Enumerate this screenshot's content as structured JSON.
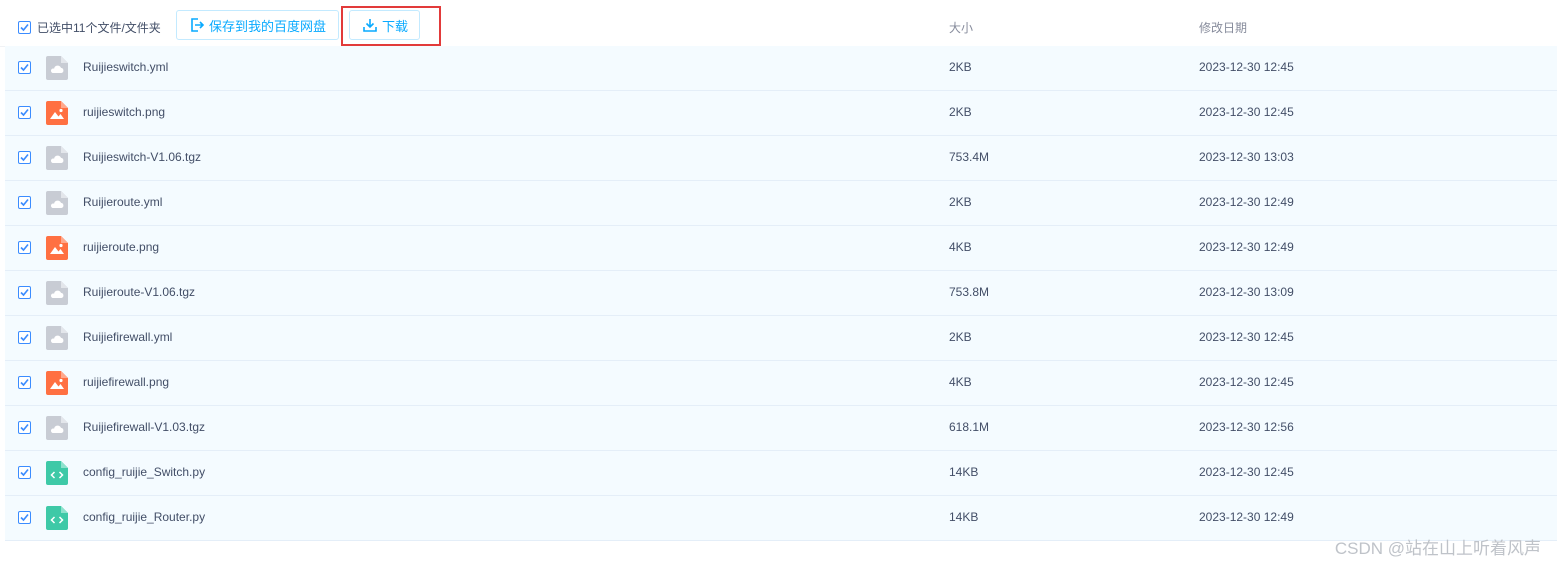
{
  "toolbar": {
    "selected_label": "已选中11个文件/文件夹",
    "save_label": "保存到我的百度网盘",
    "download_label": "下载",
    "accent_color": "#09aaff",
    "highlight_color": "#e23a3a"
  },
  "columns": {
    "size": "大小",
    "date": "修改日期"
  },
  "files": [
    {
      "name": "Ruijieswitch.yml",
      "size": "2KB",
      "date": "2023-12-30 12:45",
      "icon": "generic-file-icon"
    },
    {
      "name": "ruijieswitch.png",
      "size": "2KB",
      "date": "2023-12-30 12:45",
      "icon": "image-file-icon"
    },
    {
      "name": "Ruijieswitch-V1.06.tgz",
      "size": "753.4M",
      "date": "2023-12-30 13:03",
      "icon": "generic-file-icon"
    },
    {
      "name": "Ruijieroute.yml",
      "size": "2KB",
      "date": "2023-12-30 12:49",
      "icon": "generic-file-icon"
    },
    {
      "name": "ruijieroute.png",
      "size": "4KB",
      "date": "2023-12-30 12:49",
      "icon": "image-file-icon"
    },
    {
      "name": "Ruijieroute-V1.06.tgz",
      "size": "753.8M",
      "date": "2023-12-30 13:09",
      "icon": "generic-file-icon"
    },
    {
      "name": "Ruijiefirewall.yml",
      "size": "2KB",
      "date": "2023-12-30 12:45",
      "icon": "generic-file-icon"
    },
    {
      "name": "ruijiefirewall.png",
      "size": "4KB",
      "date": "2023-12-30 12:45",
      "icon": "image-file-icon"
    },
    {
      "name": "Ruijiefirewall-V1.03.tgz",
      "size": "618.1M",
      "date": "2023-12-30 12:56",
      "icon": "generic-file-icon"
    },
    {
      "name": "config_ruijie_Switch.py",
      "size": "14KB",
      "date": "2023-12-30 12:45",
      "icon": "code-file-icon"
    },
    {
      "name": "config_ruijie_Router.py",
      "size": "14KB",
      "date": "2023-12-30 12:49",
      "icon": "code-file-icon"
    }
  ],
  "watermark": "CSDN @站在山上听着风声"
}
